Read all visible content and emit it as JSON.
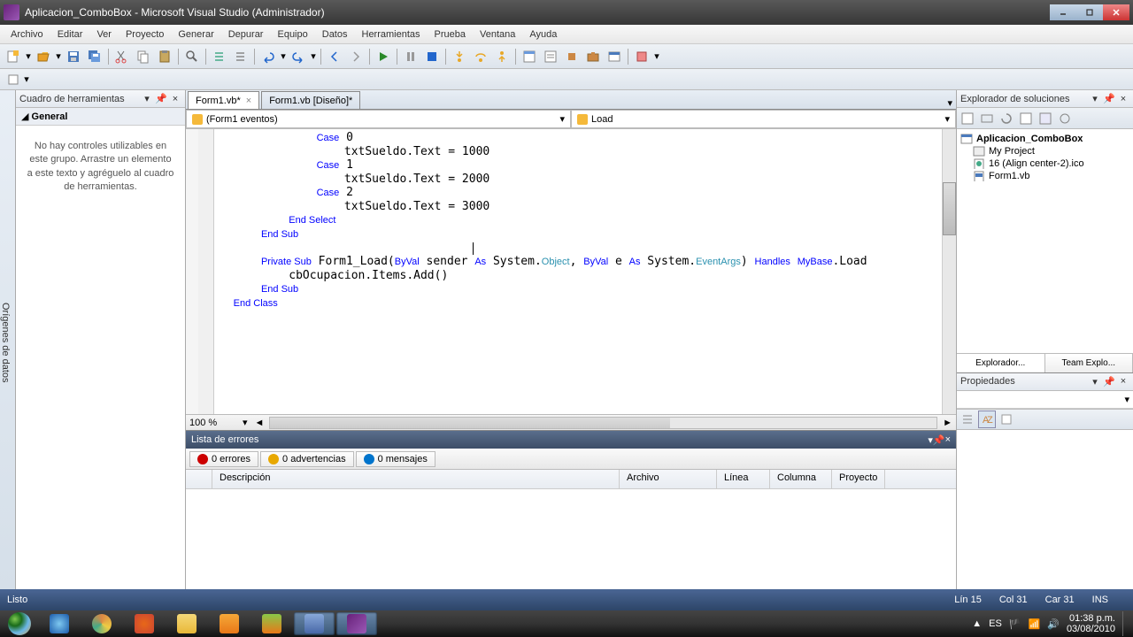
{
  "title": "Aplicacion_ComboBox - Microsoft Visual Studio (Administrador)",
  "menus": [
    "Archivo",
    "Editar",
    "Ver",
    "Proyecto",
    "Generar",
    "Depurar",
    "Equipo",
    "Datos",
    "Herramientas",
    "Prueba",
    "Ventana",
    "Ayuda"
  ],
  "leftStrip": "Orígenes de datos",
  "toolbox": {
    "title": "Cuadro de herramientas",
    "group": "General",
    "empty": "No hay controles utilizables en este grupo. Arrastre un elemento a este texto y agréguelo al cuadro de herramientas."
  },
  "tabs": [
    {
      "label": "Form1.vb*",
      "active": true
    },
    {
      "label": "Form1.vb [Diseño]*",
      "active": false
    }
  ],
  "codeNav": {
    "left": "(Form1 eventos)",
    "right": "Load"
  },
  "code": {
    "lines": [
      {
        "indent": 14,
        "tokens": [
          {
            "t": "kw",
            "v": "Case"
          },
          {
            "v": " 0"
          }
        ]
      },
      {
        "indent": 18,
        "tokens": [
          {
            "v": "txtSueldo.Text = 1000"
          }
        ]
      },
      {
        "indent": 14,
        "tokens": [
          {
            "t": "kw",
            "v": "Case"
          },
          {
            "v": " 1"
          }
        ]
      },
      {
        "indent": 18,
        "tokens": [
          {
            "v": "txtSueldo.Text = 2000"
          }
        ]
      },
      {
        "indent": 14,
        "tokens": [
          {
            "t": "kw",
            "v": "Case"
          },
          {
            "v": " 2"
          }
        ]
      },
      {
        "indent": 18,
        "tokens": [
          {
            "v": "txtSueldo.Text = 3000"
          }
        ]
      },
      {
        "indent": 10,
        "tokens": [
          {
            "t": "kw",
            "v": "End Select"
          }
        ]
      },
      {
        "indent": 6,
        "tokens": [
          {
            "t": "kw",
            "v": "End Sub"
          }
        ]
      },
      {
        "indent": 0,
        "tokens": [
          {
            "v": ""
          }
        ]
      },
      {
        "indent": 6,
        "tokens": [
          {
            "t": "kw",
            "v": "Private Sub"
          },
          {
            "v": " Form1_Load("
          },
          {
            "t": "kw",
            "v": "ByVal"
          },
          {
            "v": " sender "
          },
          {
            "t": "kw",
            "v": "As"
          },
          {
            "v": " System."
          },
          {
            "t": "type",
            "v": "Object"
          },
          {
            "v": ", "
          },
          {
            "t": "kw",
            "v": "ByVal"
          },
          {
            "v": " e "
          },
          {
            "t": "kw",
            "v": "As"
          },
          {
            "v": " System."
          },
          {
            "t": "type",
            "v": "EventArgs"
          },
          {
            "v": ") "
          },
          {
            "t": "kw",
            "v": "Handles"
          },
          {
            "v": " "
          },
          {
            "t": "kw",
            "v": "MyBase"
          },
          {
            "v": ".Load"
          }
        ]
      },
      {
        "indent": 10,
        "tokens": [
          {
            "v": "cbOcupacion.Items.Add()"
          }
        ]
      },
      {
        "indent": 6,
        "tokens": [
          {
            "t": "kw",
            "v": "End Sub"
          }
        ]
      },
      {
        "indent": 2,
        "tokens": [
          {
            "t": "kw",
            "v": "End Class"
          }
        ]
      }
    ]
  },
  "zoom": "100 %",
  "errorList": {
    "title": "Lista de errores",
    "tabs": [
      {
        "icon": "#c00",
        "label": "0 errores"
      },
      {
        "icon": "#e8a800",
        "label": "0 advertencias"
      },
      {
        "icon": "#0074cc",
        "label": "0 mensajes"
      }
    ],
    "cols": [
      "",
      "Descripción",
      "Archivo",
      "Línea",
      "Columna",
      "Proyecto"
    ]
  },
  "solutionExplorer": {
    "title": "Explorador de soluciones",
    "root": "Aplicacion_ComboBox",
    "items": [
      "My Project",
      "16 (Align center-2).ico",
      "Form1.vb"
    ]
  },
  "rightTabs": [
    "Explorador...",
    "Team Explo..."
  ],
  "properties": {
    "title": "Propiedades"
  },
  "status": {
    "ready": "Listo",
    "line": "Lín 15",
    "col": "Col 31",
    "char": "Car 31",
    "ins": "INS"
  },
  "tray": {
    "lang": "ES",
    "time": "01:38 p.m.",
    "date": "03/08/2010"
  }
}
